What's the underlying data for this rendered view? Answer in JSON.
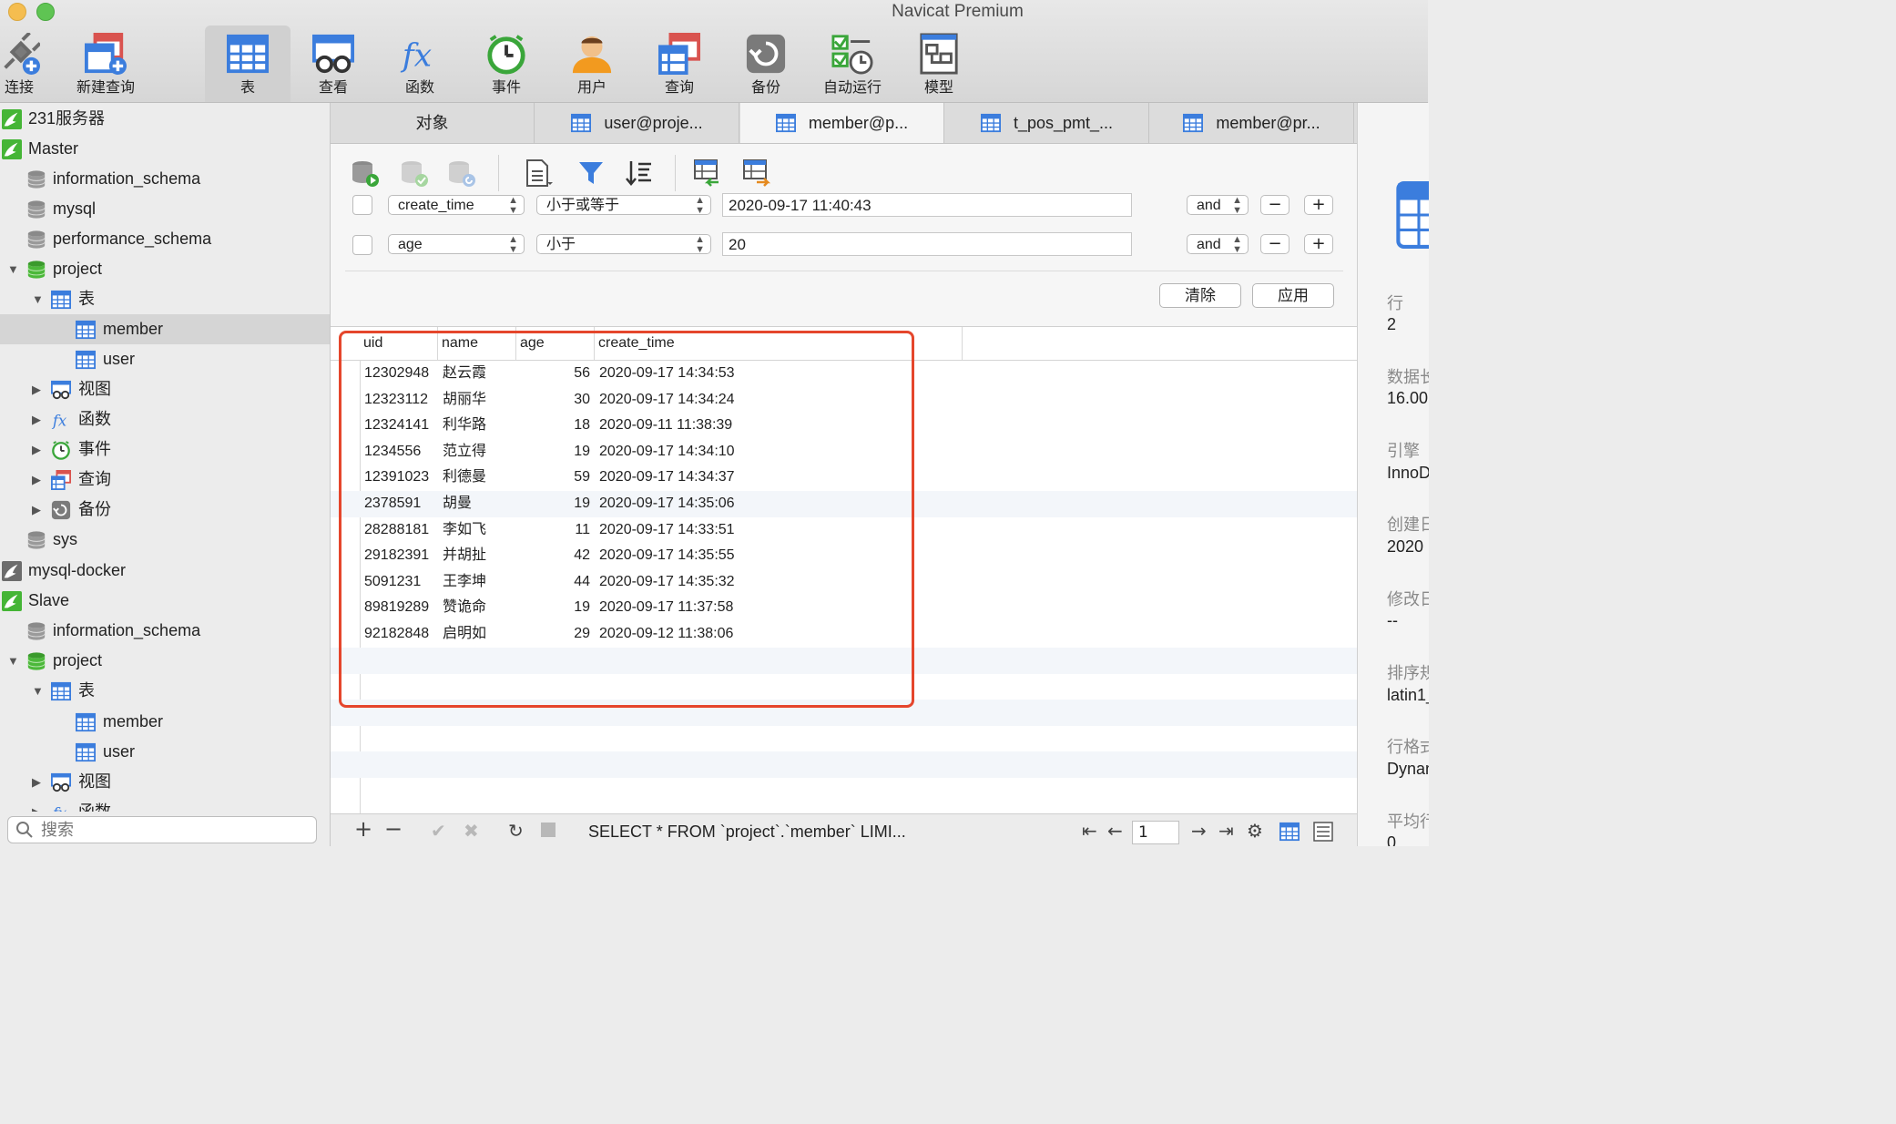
{
  "app": {
    "title": "Navicat Premium"
  },
  "toolbar": [
    {
      "label": "连接",
      "icon": "plug-icon"
    },
    {
      "label": "新建查询",
      "icon": "new-query-icon"
    },
    {
      "label": "表",
      "icon": "table-icon"
    },
    {
      "label": "查看",
      "icon": "view-icon"
    },
    {
      "label": "函数",
      "icon": "function-icon"
    },
    {
      "label": "事件",
      "icon": "clock-icon"
    },
    {
      "label": "用户",
      "icon": "user-icon"
    },
    {
      "label": "查询",
      "icon": "query-icon"
    },
    {
      "label": "备份",
      "icon": "backup-icon"
    },
    {
      "label": "自动运行",
      "icon": "auto-run-icon"
    },
    {
      "label": "模型",
      "icon": "model-icon"
    }
  ],
  "sidebar": {
    "items": [
      {
        "label": "231服务器",
        "icon": "connection-icon"
      },
      {
        "label": "Master",
        "icon": "connection-icon"
      },
      {
        "label": "information_schema",
        "icon": "database-icon"
      },
      {
        "label": "mysql",
        "icon": "database-icon"
      },
      {
        "label": "performance_schema",
        "icon": "database-icon"
      },
      {
        "label": "project",
        "icon": "database-icon"
      },
      {
        "label": "表",
        "icon": "table-icon"
      },
      {
        "label": "member",
        "icon": "table-icon"
      },
      {
        "label": "user",
        "icon": "table-icon"
      },
      {
        "label": "视图",
        "icon": "view-icon"
      },
      {
        "label": "函数",
        "icon": "function-icon"
      },
      {
        "label": "事件",
        "icon": "clock-icon"
      },
      {
        "label": "查询",
        "icon": "query-icon"
      },
      {
        "label": "备份",
        "icon": "backup-icon"
      },
      {
        "label": "sys",
        "icon": "database-icon"
      },
      {
        "label": "mysql-docker",
        "icon": "connection-icon"
      },
      {
        "label": "Slave",
        "icon": "connection-icon"
      },
      {
        "label": "information_schema",
        "icon": "database-icon"
      },
      {
        "label": "project",
        "icon": "database-icon"
      },
      {
        "label": "表",
        "icon": "table-icon"
      },
      {
        "label": "member",
        "icon": "table-icon"
      },
      {
        "label": "user",
        "icon": "table-icon"
      },
      {
        "label": "视图",
        "icon": "view-icon"
      },
      {
        "label": "函数",
        "icon": "function-icon"
      }
    ],
    "search_placeholder": "搜索"
  },
  "tabs": [
    {
      "label": "对象"
    },
    {
      "label": "user@proje..."
    },
    {
      "label": "member@p..."
    },
    {
      "label": "t_pos_pmt_..."
    },
    {
      "label": "member@pr..."
    }
  ],
  "filter": {
    "rows": [
      {
        "field": "create_time",
        "operator": "小于或等于",
        "value": "2020-09-17 11:40:43",
        "logic": "and"
      },
      {
        "field": "age",
        "operator": "小于",
        "value": "20",
        "logic": "and"
      }
    ],
    "minus_label": "−",
    "plus_label": "+",
    "clear_label": "清除",
    "apply_label": "应用"
  },
  "grid": {
    "columns": [
      "uid",
      "name",
      "age",
      "create_time"
    ],
    "rows": [
      [
        "12302948",
        "赵云霞",
        "56",
        "2020-09-17 14:34:53"
      ],
      [
        "12323112",
        "胡丽华",
        "30",
        "2020-09-17 14:34:24"
      ],
      [
        "12324141",
        "利华路",
        "18",
        "2020-09-11 11:38:39"
      ],
      [
        "1234556",
        "范立得",
        "19",
        "2020-09-17 14:34:10"
      ],
      [
        "12391023",
        "利德曼",
        "59",
        "2020-09-17 14:34:37"
      ],
      [
        "2378591",
        "胡曼",
        "19",
        "2020-09-17 14:35:06"
      ],
      [
        "28288181",
        "李如飞",
        "11",
        "2020-09-17 14:33:51"
      ],
      [
        "29182391",
        "并胡扯",
        "42",
        "2020-09-17 14:35:55"
      ],
      [
        "5091231",
        "王李坤",
        "44",
        "2020-09-17 14:35:32"
      ],
      [
        "89819289",
        "赞诡命",
        "19",
        "2020-09-17 11:37:58"
      ],
      [
        "92182848",
        "启明如",
        "29",
        "2020-09-12 11:38:06"
      ]
    ]
  },
  "bottom": {
    "sql": "SELECT * FROM `project`.`member` LIMI...",
    "page": "1"
  },
  "info": {
    "items": [
      {
        "key": "行",
        "value": "2"
      },
      {
        "key": "数据长",
        "value": "16.00"
      },
      {
        "key": "引擎",
        "value": "InnoDB"
      },
      {
        "key": "创建日",
        "value": "2020"
      },
      {
        "key": "修改日",
        "value": "--"
      },
      {
        "key": "排序规",
        "value": "latin1_"
      },
      {
        "key": "行格式",
        "value": "Dynamic"
      },
      {
        "key": "平均行",
        "value": "0"
      }
    ]
  },
  "colors": {
    "accent": "#3b7ddd",
    "highlight_border": "#e5462c",
    "connection_green": "#45b536"
  }
}
